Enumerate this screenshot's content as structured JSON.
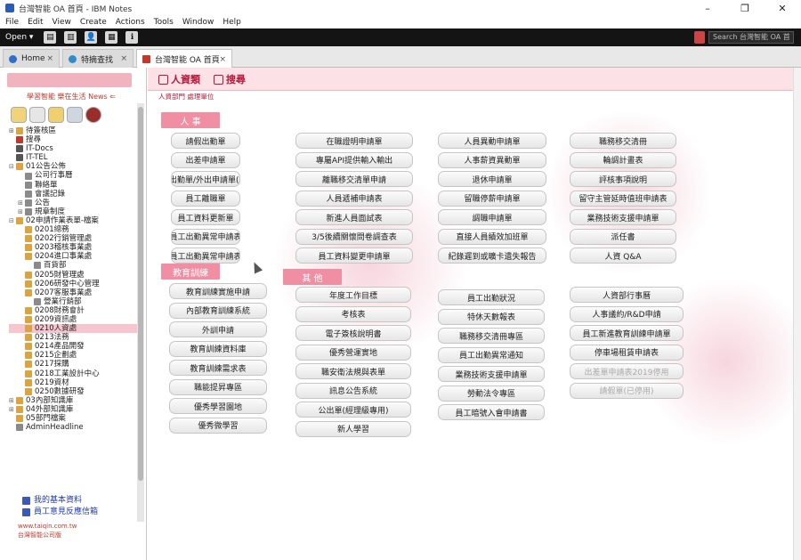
{
  "window": {
    "title": "台灣智能 OA 首頁 - IBM Notes",
    "controls": [
      "–",
      "❐",
      "✕"
    ]
  },
  "menu": [
    "File",
    "Edit",
    "View",
    "Create",
    "Actions",
    "Tools",
    "Window",
    "Help"
  ],
  "toolbar": {
    "open_label": "Open ▾",
    "buttons": [
      "▤",
      "▥",
      "👤",
      "▦",
      "ℹ"
    ],
    "search_placeholder": "Search 台灣智能 OA 首"
  },
  "tabs": [
    {
      "label": "Home",
      "color": "#2f6fc9"
    },
    {
      "label": "特摘查找",
      "color": "#2f8ec9"
    },
    {
      "label": "台灣智能 OA 首頁",
      "color": "#c0392b",
      "active": true
    }
  ],
  "sidebar": {
    "news_text": "學習智能 樂在生活 News ⇐",
    "tree": [
      {
        "label": "待簽核區",
        "exp": "⊞",
        "indent": 0,
        "color": "#d9a441"
      },
      {
        "label": "搜尋",
        "exp": "",
        "indent": 0,
        "color": "#c0392b"
      },
      {
        "label": "IT-Docs",
        "exp": "",
        "indent": 0,
        "color": "#555"
      },
      {
        "label": "IT-TEL",
        "exp": "",
        "indent": 0,
        "color": "#555"
      },
      {
        "label": "01公告公佈",
        "exp": "⊟",
        "indent": 0,
        "color": "#d9a441"
      },
      {
        "label": "公司行事曆",
        "exp": "",
        "indent": 1,
        "color": "#8a8a8a"
      },
      {
        "label": "聯絡單",
        "exp": "",
        "indent": 1,
        "color": "#8a8a8a"
      },
      {
        "label": "會議記錄",
        "exp": "",
        "indent": 1,
        "color": "#8a8a8a"
      },
      {
        "label": "公告",
        "exp": "⊞",
        "indent": 1,
        "color": "#8a8a8a"
      },
      {
        "label": "規章制度",
        "exp": "⊞",
        "indent": 1,
        "color": "#8a8a8a"
      },
      {
        "label": "02申請作業表單-檔案",
        "exp": "⊟",
        "indent": 0,
        "color": "#d9a441"
      },
      {
        "label": "0201總務",
        "exp": "",
        "indent": 1,
        "color": "#d9a441"
      },
      {
        "label": "0202行銷管理處",
        "exp": "",
        "indent": 1,
        "color": "#d9a441"
      },
      {
        "label": "0203稽核事業處",
        "exp": "",
        "indent": 1,
        "color": "#d9a441"
      },
      {
        "label": "0204進口事業處",
        "exp": "",
        "indent": 1,
        "color": "#d9a441"
      },
      {
        "label": "百貨部",
        "exp": "",
        "indent": 2,
        "color": "#8a8a8a"
      },
      {
        "label": "0205財管理處",
        "exp": "",
        "indent": 1,
        "color": "#d9a441"
      },
      {
        "label": "0206研發中心管理",
        "exp": "",
        "indent": 1,
        "color": "#d9a441"
      },
      {
        "label": "0207客服事業處",
        "exp": "",
        "indent": 1,
        "color": "#d9a441"
      },
      {
        "label": "營業行銷部",
        "exp": "",
        "indent": 2,
        "color": "#8a8a8a"
      },
      {
        "label": "0208財務會計",
        "exp": "",
        "indent": 1,
        "color": "#d9a441"
      },
      {
        "label": "0209資訊處",
        "exp": "",
        "indent": 1,
        "color": "#d9a441"
      },
      {
        "label": "0210人資處",
        "exp": "",
        "indent": 1,
        "color": "#d9a441",
        "selected": true
      },
      {
        "label": "0213法務",
        "exp": "",
        "indent": 1,
        "color": "#d9a441"
      },
      {
        "label": "0214產品開發",
        "exp": "",
        "indent": 1,
        "color": "#d9a441"
      },
      {
        "label": "0215企劃處",
        "exp": "",
        "indent": 1,
        "color": "#d9a441"
      },
      {
        "label": "0217採購",
        "exp": "",
        "indent": 1,
        "color": "#d9a441"
      },
      {
        "label": "0218工業設計中心",
        "exp": "",
        "indent": 1,
        "color": "#d9a441"
      },
      {
        "label": "0219資材",
        "exp": "",
        "indent": 1,
        "color": "#d9a441"
      },
      {
        "label": "0250數據研發",
        "exp": "",
        "indent": 1,
        "color": "#d9a441"
      },
      {
        "label": "03內部知識庫",
        "exp": "⊞",
        "indent": 0,
        "color": "#d9a441"
      },
      {
        "label": "04外部知識庫",
        "exp": "⊞",
        "indent": 0,
        "color": "#d9a441"
      },
      {
        "label": "05部門檔案",
        "exp": "",
        "indent": 0,
        "color": "#d9a441"
      },
      {
        "label": "AdminHeadline",
        "exp": "",
        "indent": 0,
        "color": "#8a8a8a"
      }
    ],
    "links": [
      "我的基本資料",
      "員工意見反應信箱"
    ],
    "footer_lines": [
      "www.taiqin.com.tw",
      "台灣智能公司版"
    ]
  },
  "main": {
    "header_tabs": [
      "人資類",
      "搜尋"
    ],
    "subbar": "人資部門  處理單位",
    "sections": {
      "hr": "人 事",
      "training": "教育訓練",
      "other": "其 他"
    },
    "col1_hr": [
      "請假出勤單",
      "出差申請單",
      "公出出勤單/外出申請單(核准)",
      "員工離職單",
      "員工資料更新單",
      "員工出勤異常申請表",
      "員工出勤異常申請表"
    ],
    "col2_hr": [
      "在職證明申請單",
      "專屬API提供輸入輸出",
      "離職移交清單申請",
      "人員遞補申請表",
      "新進人員面試表",
      "3/5後續關懷問卷調查表",
      "員工資料變更申請單"
    ],
    "col3_hr": [
      "人員異動申請單",
      "人事薪資異動單",
      "退休申請單",
      "留職停薪申請單",
      "調職申請單",
      "直接人員績效加班單",
      "紀錄遲到或曠卡遺失報告"
    ],
    "col4_hr": [
      "職務移交清冊",
      "輪調計畫表",
      "評核事項說明",
      "留守主管延時值班申請表",
      "業務技術支援申請單",
      "派任書",
      "人資 Q&A"
    ],
    "col1_training": [
      "教育訓練實施申請",
      "內部教育訓練系統",
      "外訓申請",
      "教育訓練資料庫",
      "教育訓練需求表",
      "職能提昇專區",
      "優秀學習園地",
      "優秀微學習"
    ],
    "col2_other": [
      "年度工作目標",
      "考核表",
      "電子簽核說明書",
      "優秀營運實地",
      "職安衛法規與表單",
      "訊息公告系統",
      "公出單(經理級專用)",
      "新人學習"
    ],
    "col3_other": [
      "員工出勤狀況",
      "特休天數報表",
      "職務移交清冊專區",
      "員工出勤異常通知",
      "業務技術支援申請單",
      "勞動法令專區",
      "員工暗號入會申請書"
    ],
    "col4_other": [
      "人資部行事曆",
      "人事議約/R&D申請",
      "員工新進教育訓練申請單",
      "停車場租賃申請表",
      "出差單申請表2019停用",
      "請假單(已停用)"
    ]
  }
}
